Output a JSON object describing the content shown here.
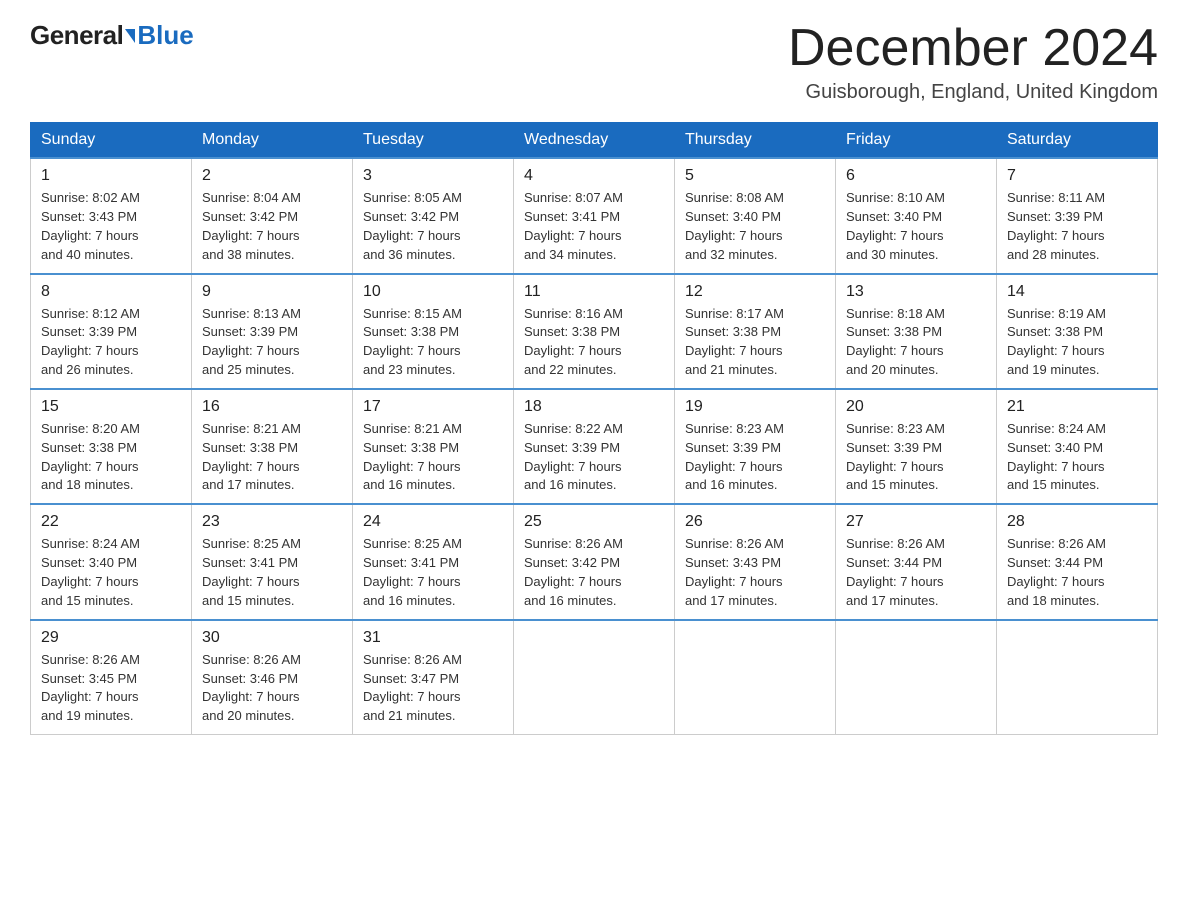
{
  "logo": {
    "general": "General",
    "blue": "Blue"
  },
  "title": "December 2024",
  "location": "Guisborough, England, United Kingdom",
  "days_of_week": [
    "Sunday",
    "Monday",
    "Tuesday",
    "Wednesday",
    "Thursday",
    "Friday",
    "Saturday"
  ],
  "weeks": [
    [
      {
        "day": "1",
        "sunrise": "8:02 AM",
        "sunset": "3:43 PM",
        "daylight": "7 hours and 40 minutes."
      },
      {
        "day": "2",
        "sunrise": "8:04 AM",
        "sunset": "3:42 PM",
        "daylight": "7 hours and 38 minutes."
      },
      {
        "day": "3",
        "sunrise": "8:05 AM",
        "sunset": "3:42 PM",
        "daylight": "7 hours and 36 minutes."
      },
      {
        "day": "4",
        "sunrise": "8:07 AM",
        "sunset": "3:41 PM",
        "daylight": "7 hours and 34 minutes."
      },
      {
        "day": "5",
        "sunrise": "8:08 AM",
        "sunset": "3:40 PM",
        "daylight": "7 hours and 32 minutes."
      },
      {
        "day": "6",
        "sunrise": "8:10 AM",
        "sunset": "3:40 PM",
        "daylight": "7 hours and 30 minutes."
      },
      {
        "day": "7",
        "sunrise": "8:11 AM",
        "sunset": "3:39 PM",
        "daylight": "7 hours and 28 minutes."
      }
    ],
    [
      {
        "day": "8",
        "sunrise": "8:12 AM",
        "sunset": "3:39 PM",
        "daylight": "7 hours and 26 minutes."
      },
      {
        "day": "9",
        "sunrise": "8:13 AM",
        "sunset": "3:39 PM",
        "daylight": "7 hours and 25 minutes."
      },
      {
        "day": "10",
        "sunrise": "8:15 AM",
        "sunset": "3:38 PM",
        "daylight": "7 hours and 23 minutes."
      },
      {
        "day": "11",
        "sunrise": "8:16 AM",
        "sunset": "3:38 PM",
        "daylight": "7 hours and 22 minutes."
      },
      {
        "day": "12",
        "sunrise": "8:17 AM",
        "sunset": "3:38 PM",
        "daylight": "7 hours and 21 minutes."
      },
      {
        "day": "13",
        "sunrise": "8:18 AM",
        "sunset": "3:38 PM",
        "daylight": "7 hours and 20 minutes."
      },
      {
        "day": "14",
        "sunrise": "8:19 AM",
        "sunset": "3:38 PM",
        "daylight": "7 hours and 19 minutes."
      }
    ],
    [
      {
        "day": "15",
        "sunrise": "8:20 AM",
        "sunset": "3:38 PM",
        "daylight": "7 hours and 18 minutes."
      },
      {
        "day": "16",
        "sunrise": "8:21 AM",
        "sunset": "3:38 PM",
        "daylight": "7 hours and 17 minutes."
      },
      {
        "day": "17",
        "sunrise": "8:21 AM",
        "sunset": "3:38 PM",
        "daylight": "7 hours and 16 minutes."
      },
      {
        "day": "18",
        "sunrise": "8:22 AM",
        "sunset": "3:39 PM",
        "daylight": "7 hours and 16 minutes."
      },
      {
        "day": "19",
        "sunrise": "8:23 AM",
        "sunset": "3:39 PM",
        "daylight": "7 hours and 16 minutes."
      },
      {
        "day": "20",
        "sunrise": "8:23 AM",
        "sunset": "3:39 PM",
        "daylight": "7 hours and 15 minutes."
      },
      {
        "day": "21",
        "sunrise": "8:24 AM",
        "sunset": "3:40 PM",
        "daylight": "7 hours and 15 minutes."
      }
    ],
    [
      {
        "day": "22",
        "sunrise": "8:24 AM",
        "sunset": "3:40 PM",
        "daylight": "7 hours and 15 minutes."
      },
      {
        "day": "23",
        "sunrise": "8:25 AM",
        "sunset": "3:41 PM",
        "daylight": "7 hours and 15 minutes."
      },
      {
        "day": "24",
        "sunrise": "8:25 AM",
        "sunset": "3:41 PM",
        "daylight": "7 hours and 16 minutes."
      },
      {
        "day": "25",
        "sunrise": "8:26 AM",
        "sunset": "3:42 PM",
        "daylight": "7 hours and 16 minutes."
      },
      {
        "day": "26",
        "sunrise": "8:26 AM",
        "sunset": "3:43 PM",
        "daylight": "7 hours and 17 minutes."
      },
      {
        "day": "27",
        "sunrise": "8:26 AM",
        "sunset": "3:44 PM",
        "daylight": "7 hours and 17 minutes."
      },
      {
        "day": "28",
        "sunrise": "8:26 AM",
        "sunset": "3:44 PM",
        "daylight": "7 hours and 18 minutes."
      }
    ],
    [
      {
        "day": "29",
        "sunrise": "8:26 AM",
        "sunset": "3:45 PM",
        "daylight": "7 hours and 19 minutes."
      },
      {
        "day": "30",
        "sunrise": "8:26 AM",
        "sunset": "3:46 PM",
        "daylight": "7 hours and 20 minutes."
      },
      {
        "day": "31",
        "sunrise": "8:26 AM",
        "sunset": "3:47 PM",
        "daylight": "7 hours and 21 minutes."
      },
      null,
      null,
      null,
      null
    ]
  ],
  "labels": {
    "sunrise": "Sunrise:",
    "sunset": "Sunset:",
    "daylight": "Daylight:"
  }
}
